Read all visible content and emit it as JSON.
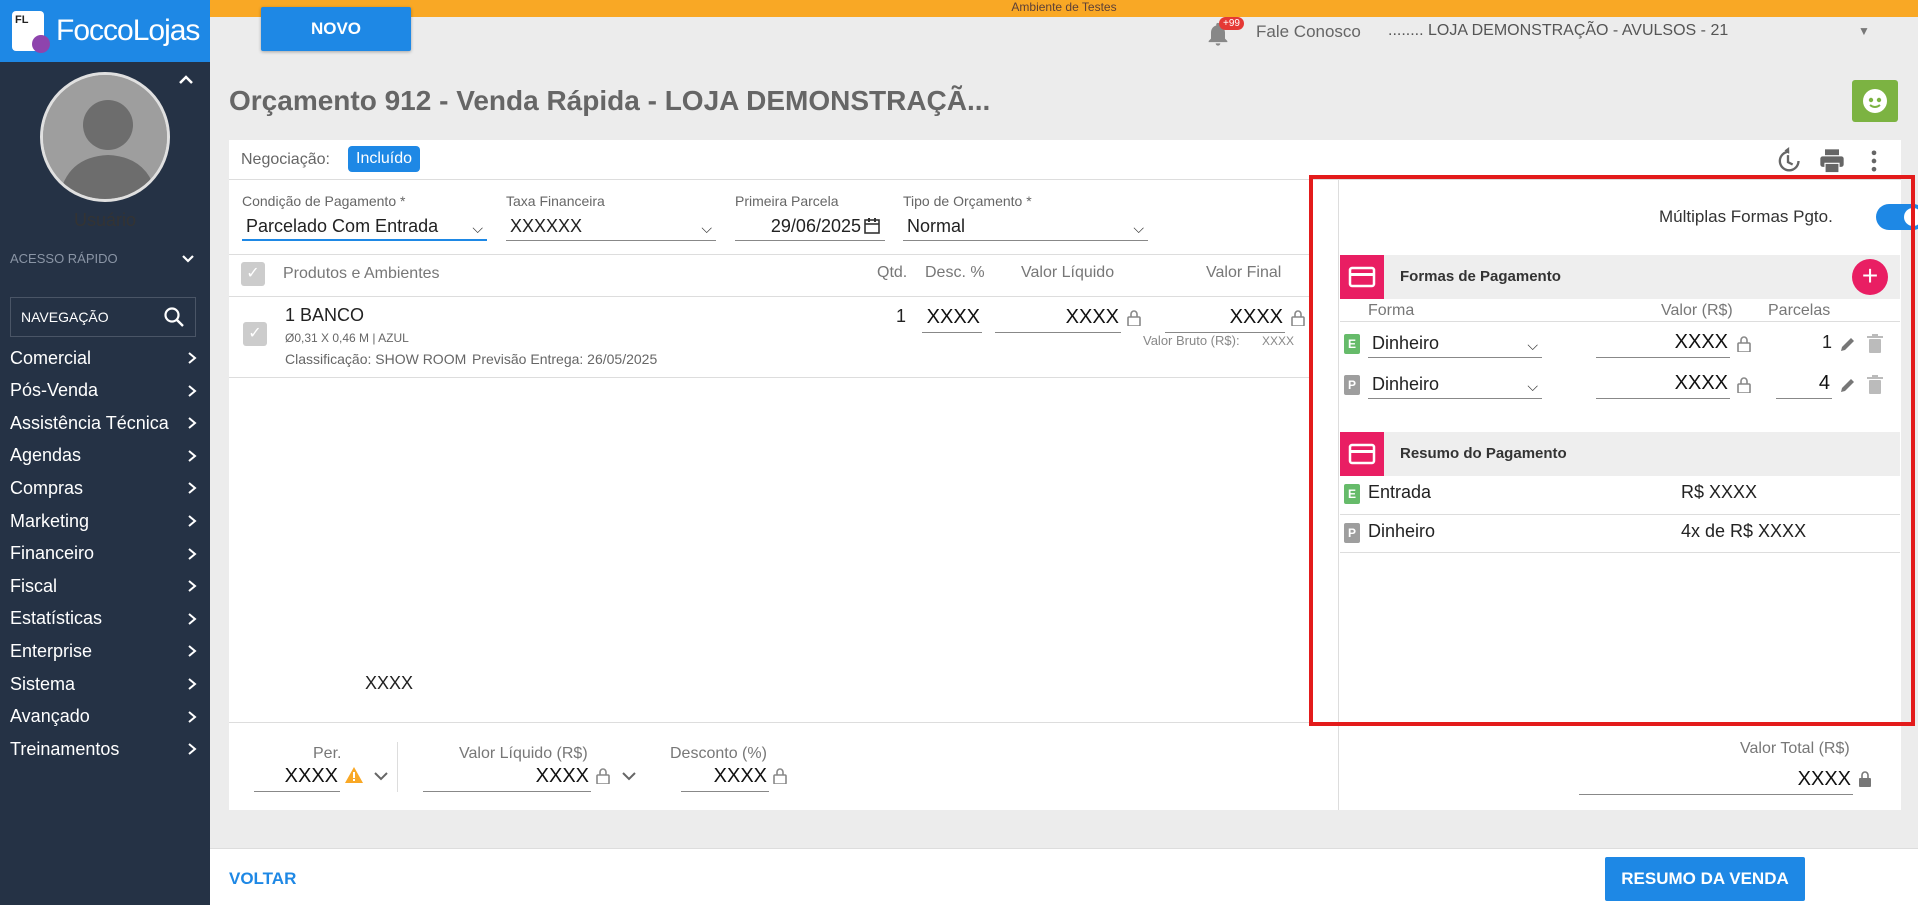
{
  "env_banner": "Ambiente de Testes",
  "brand": {
    "logo_text": "FoccoLojas",
    "logo_mark": "FL"
  },
  "header": {
    "novo_label": "NOVO",
    "notification_badge": "+99",
    "fale_conosco": "Fale Conosco",
    "store": "........ LOJA DEMONSTRAÇÃO - AVULSOS - 21"
  },
  "sidebar": {
    "username": "Usuário",
    "quick_access": "ACESSO RÁPIDO",
    "nav_placeholder": "NAVEGAÇÃO",
    "items": [
      "Comercial",
      "Pós-Venda",
      "Assistência Técnica",
      "Agendas",
      "Compras",
      "Marketing",
      "Financeiro",
      "Fiscal",
      "Estatísticas",
      "Enterprise",
      "Sistema",
      "Avançado",
      "Treinamentos"
    ]
  },
  "page": {
    "title": "Orçamento 912 - Venda Rápida - LOJA DEMONSTRAÇÃ...",
    "negotiation_label": "Negociação:",
    "negotiation_status": "Incluído"
  },
  "form": {
    "payment_condition_label": "Condição de Pagamento *",
    "payment_condition_value": "Parcelado Com Entrada",
    "financial_rate_label": "Taxa Financeira",
    "financial_rate_value": "XXXXXX",
    "first_installment_label": "Primeira Parcela",
    "first_installment_value": "29/06/2025",
    "budget_type_label": "Tipo de Orçamento *",
    "budget_type_value": "Normal"
  },
  "products": {
    "headers": {
      "name": "Produtos e Ambientes",
      "qty": "Qtd.",
      "disc": "Desc. %",
      "net": "Valor Líquido",
      "final": "Valor Final"
    },
    "item": {
      "name": "1 BANCO",
      "dims": "Ø0,31 X 0,46 M | AZUL",
      "classification": "Classificação: SHOW ROOM",
      "delivery": "Previsão Entrega: 26/05/2025",
      "qty": "1",
      "disc": "XXXX",
      "net": "XXXX",
      "final": "XXXX",
      "gross_label": "Valor Bruto (R$):",
      "gross_value": "XXXX"
    },
    "loose_text": "XXXX"
  },
  "totals": {
    "per_label": "Per.",
    "per_value": "XXXX",
    "net_label": "Valor Líquido (R$)",
    "net_value": "XXXX",
    "discount_label": "Desconto (%)",
    "discount_value": "XXXX",
    "total_label": "Valor Total (R$)",
    "total_value": "XXXX"
  },
  "payments": {
    "multi_label": "Múltiplas Formas Pgto.",
    "multi_enabled": true,
    "section_title": "Formas de Pagamento",
    "headers": {
      "forma": "Forma",
      "valor": "Valor (R$)",
      "parcelas": "Parcelas"
    },
    "rows": [
      {
        "tag": "E",
        "forma": "Dinheiro",
        "valor": "XXXX",
        "parcelas": "1"
      },
      {
        "tag": "P",
        "forma": "Dinheiro",
        "valor": "XXXX",
        "parcelas": "4"
      }
    ],
    "summary_title": "Resumo do Pagamento",
    "summary": [
      {
        "tag": "E",
        "label": "Entrada",
        "value": "R$ XXXX"
      },
      {
        "tag": "P",
        "label": "Dinheiro",
        "value": "4x de R$ XXXX"
      }
    ]
  },
  "footer": {
    "back": "VOLTAR",
    "summary_button": "RESUMO DA VENDA"
  },
  "colors": {
    "primary": "#1e88e5",
    "accent": "#e91e63",
    "sidebar": "#253245",
    "warning": "#f9a825",
    "highlight_box": "#e31b1b"
  }
}
